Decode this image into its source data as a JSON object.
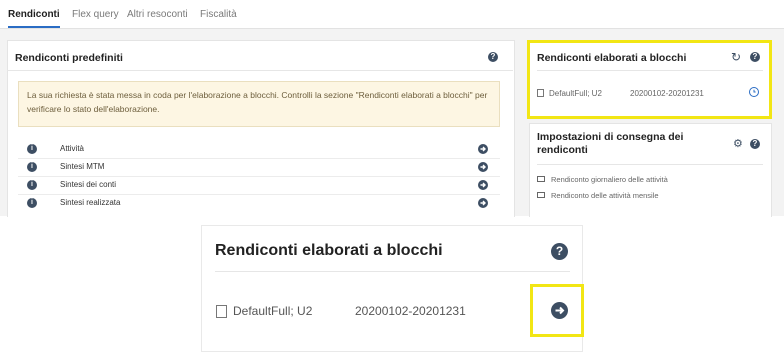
{
  "tabs": [
    {
      "label": "Rendiconti",
      "active": true
    },
    {
      "label": "Flex query",
      "active": false
    },
    {
      "label": "Altri resoconti",
      "active": false
    },
    {
      "label": "Fiscalità",
      "active": false
    }
  ],
  "left_panel": {
    "title": "Rendiconti predefiniti",
    "notice": "La sua richiesta è stata messa in coda per l'elaborazione a blocchi. Controlli la sezione \"Rendiconti elaborati a blocchi\" per verificare lo stato dell'elaborazione.",
    "rows": [
      "Attività",
      "Sintesi MTM",
      "Sintesi dei conti",
      "Sintesi realizzata"
    ]
  },
  "batch_panel": {
    "title": "Rendiconti elaborati a blocchi",
    "item_name": "DefaultFull; U2",
    "item_range": "20200102-20201231"
  },
  "delivery_panel": {
    "title": "Impostazioni di consegna dei rendiconti",
    "items": [
      "Rendiconto giornaliero delle attività",
      "Rendiconto delle attività mensile"
    ]
  },
  "zoom_panel": {
    "title": "Rendiconti elaborati a blocchi",
    "item_name": "DefaultFull; U2",
    "item_range": "20200102-20201231"
  },
  "icons": {
    "help": "?",
    "info": "i"
  },
  "colors": {
    "highlight": "#f2e614",
    "accent": "#2a6cc4",
    "icon": "#3d4e63"
  }
}
